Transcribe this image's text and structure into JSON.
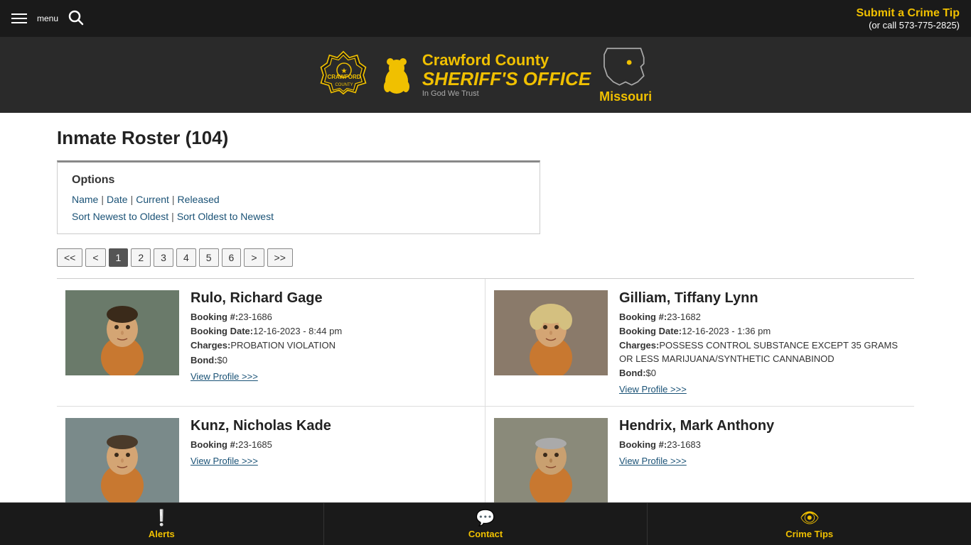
{
  "header": {
    "menu_label": "menu",
    "crime_tip_text": "Submit a Crime Tip",
    "crime_tip_phone": "(or call 573-775-2825)"
  },
  "logo": {
    "crawford_county": "Crawford County",
    "sheriffs_office": "SHERIFF'S OFFICE",
    "in_god": "In God We Trust",
    "missouri": "Missouri"
  },
  "page": {
    "title": "Inmate Roster (104)"
  },
  "options": {
    "title": "Options",
    "filter_links": [
      {
        "label": "Name",
        "id": "name"
      },
      {
        "label": "Date",
        "id": "date"
      },
      {
        "label": "Current",
        "id": "current"
      },
      {
        "label": "Released",
        "id": "released"
      }
    ],
    "sort_links": [
      {
        "label": "Sort Newest to Oldest",
        "id": "sort-newest"
      },
      {
        "label": "Sort Oldest to Newest",
        "id": "sort-oldest"
      }
    ]
  },
  "pagination": {
    "buttons": [
      "<<",
      "<",
      "1",
      "2",
      "3",
      "4",
      "5",
      "6",
      ">",
      ">>"
    ],
    "active": "1"
  },
  "inmates": [
    {
      "id": "rulo",
      "name": "Rulo, Richard Gage",
      "booking_number": "23-1686",
      "booking_date": "12-16-2023 - 8:44 pm",
      "charges": "PROBATION VIOLATION",
      "bond": "$0",
      "view_profile_label": "View Profile >>>",
      "photo_bg": "#6a7a6a"
    },
    {
      "id": "gilliam",
      "name": "Gilliam, Tiffany Lynn",
      "booking_number": "23-1682",
      "booking_date": "12-16-2023 - 1:36 pm",
      "charges": "POSSESS CONTROL SUBSTANCE EXCEPT 35 GRAMS OR LESS MARIJUANA/SYNTHETIC CANNABINOD",
      "bond": "$0",
      "view_profile_label": "View Profile >>>",
      "photo_bg": "#9a8a7a"
    },
    {
      "id": "kunz",
      "name": "Kunz, Nicholas Kade",
      "booking_number": "23-1685",
      "booking_date": "",
      "charges": "",
      "bond": "",
      "view_profile_label": "View Profile >>>",
      "photo_bg": "#7a8a8a"
    },
    {
      "id": "hendrix",
      "name": "Hendrix, Mark Anthony",
      "booking_number": "23-1683",
      "booking_date": "",
      "charges": "",
      "bond": "",
      "view_profile_label": "View Profile >>>",
      "photo_bg": "#8a8a7a"
    }
  ],
  "labels": {
    "booking_number": "Booking #:",
    "booking_date": "Booking Date:",
    "charges": "Charges:",
    "bond": "Bond:"
  },
  "bottom_nav": [
    {
      "label": "Alerts",
      "icon": "❕",
      "id": "alerts"
    },
    {
      "label": "Contact",
      "icon": "💬",
      "id": "contact"
    },
    {
      "label": "Crime Tips",
      "icon": "👁",
      "id": "crime-tips"
    }
  ]
}
